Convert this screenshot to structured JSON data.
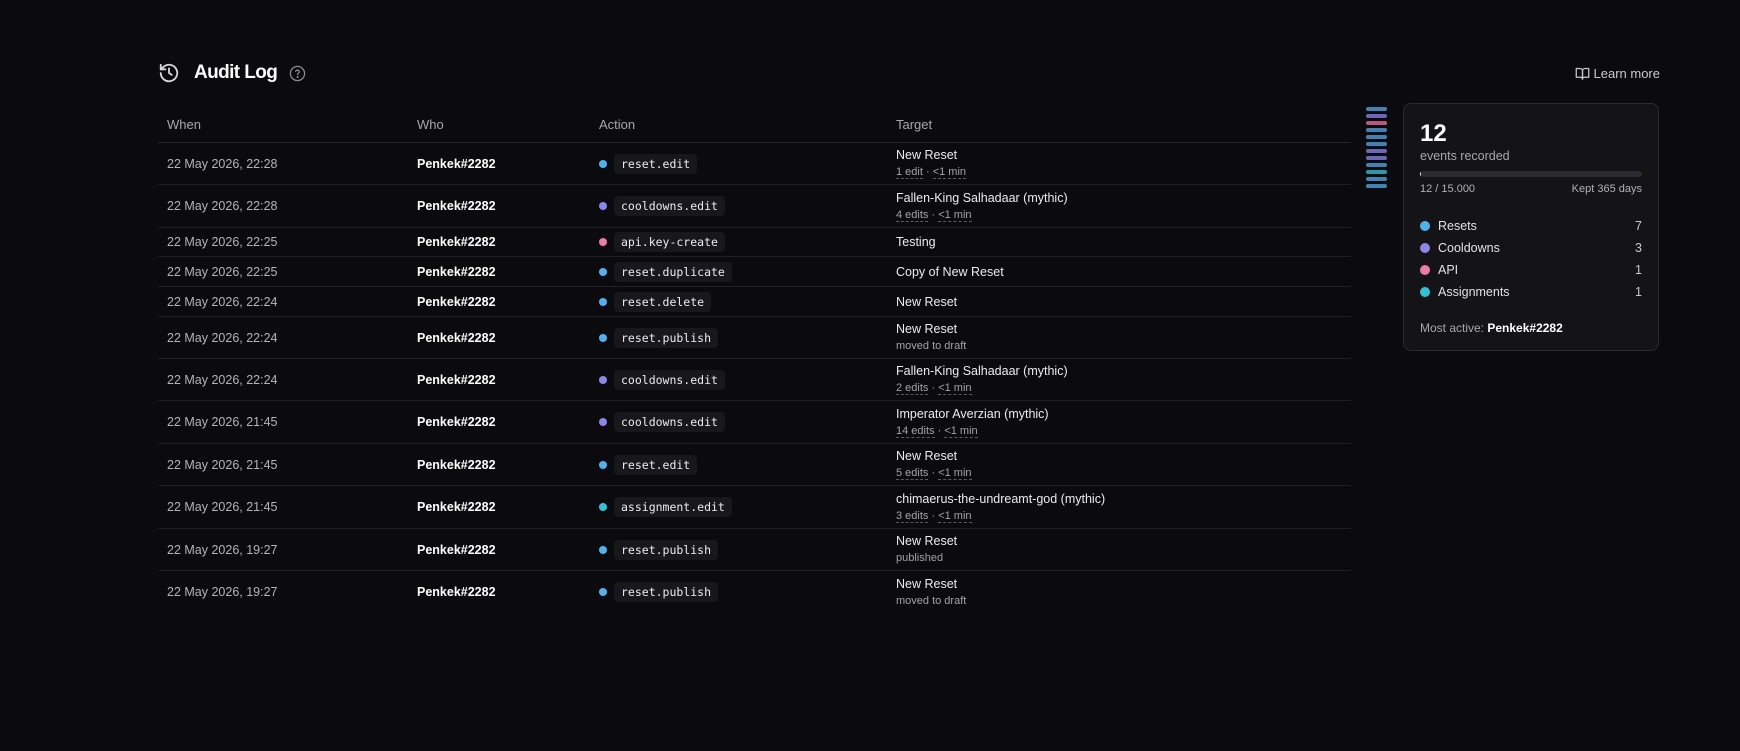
{
  "header": {
    "title": "Audit Log",
    "learn_more": "Learn more"
  },
  "table": {
    "columns": {
      "when": "When",
      "who": "Who",
      "action": "Action",
      "target": "Target"
    },
    "rows": [
      {
        "when": "22 May 2026, 22:28",
        "who": "Penkek#2282",
        "action": "reset.edit",
        "color": "#4db3f0",
        "target": "New Reset",
        "sub": "1 edit · <1 min"
      },
      {
        "when": "22 May 2026, 22:28",
        "who": "Penkek#2282",
        "action": "cooldowns.edit",
        "color": "#8a86ea",
        "target": "Fallen-King Salhadaar (mythic)",
        "sub": "4 edits · <1 min"
      },
      {
        "when": "22 May 2026, 22:25",
        "who": "Penkek#2282",
        "action": "api.key-create",
        "color": "#ee7aa6",
        "target": "Testing",
        "sub": ""
      },
      {
        "when": "22 May 2026, 22:25",
        "who": "Penkek#2282",
        "action": "reset.duplicate",
        "color": "#4db3f0",
        "target": "Copy of New Reset",
        "sub": ""
      },
      {
        "when": "22 May 2026, 22:24",
        "who": "Penkek#2282",
        "action": "reset.delete",
        "color": "#4db3f0",
        "target": "New Reset",
        "sub": ""
      },
      {
        "when": "22 May 2026, 22:24",
        "who": "Penkek#2282",
        "action": "reset.publish",
        "color": "#4db3f0",
        "target": "New Reset",
        "sub": "moved to draft"
      },
      {
        "when": "22 May 2026, 22:24",
        "who": "Penkek#2282",
        "action": "cooldowns.edit",
        "color": "#8a86ea",
        "target": "Fallen-King Salhadaar (mythic)",
        "sub": "2 edits · <1 min"
      },
      {
        "when": "22 May 2026, 21:45",
        "who": "Penkek#2282",
        "action": "cooldowns.edit",
        "color": "#8a86ea",
        "target": "Imperator Averzian (mythic)",
        "sub": "14 edits · <1 min"
      },
      {
        "when": "22 May 2026, 21:45",
        "who": "Penkek#2282",
        "action": "reset.edit",
        "color": "#4db3f0",
        "target": "New Reset",
        "sub": "5 edits · <1 min"
      },
      {
        "when": "22 May 2026, 21:45",
        "who": "Penkek#2282",
        "action": "assignment.edit",
        "color": "#2ec4d6",
        "target": "chimaerus-the-undreamt-god (mythic)",
        "sub": "3 edits · <1 min"
      },
      {
        "when": "22 May 2026, 19:27",
        "who": "Penkek#2282",
        "action": "reset.publish",
        "color": "#4db3f0",
        "target": "New Reset",
        "sub": "published"
      },
      {
        "when": "22 May 2026, 19:27",
        "who": "Penkek#2282",
        "action": "reset.publish",
        "color": "#4db3f0",
        "target": "New Reset",
        "sub": "moved to draft"
      }
    ]
  },
  "minimap": {
    "bars": [
      "#3f82b5",
      "#6a66b8",
      "#b8587f",
      "#3f82b5",
      "#3f82b5",
      "#3f82b5",
      "#6a66b8",
      "#6a66b8",
      "#3f82b5",
      "#279aa8",
      "#3f82b5",
      "#3f82b5"
    ]
  },
  "stats": {
    "count": "12",
    "count_label": "events recorded",
    "progress_fraction": 0.0008,
    "progress_text": "12 / 15.000",
    "retention": "Kept 365 days",
    "legend": [
      {
        "label": "Resets",
        "value": "7",
        "color": "#4db3f0"
      },
      {
        "label": "Cooldowns",
        "value": "3",
        "color": "#8a86ea"
      },
      {
        "label": "API",
        "value": "1",
        "color": "#ee7aa6"
      },
      {
        "label": "Assignments",
        "value": "1",
        "color": "#2ec4d6"
      }
    ],
    "most_active_label": "Most active:",
    "most_active_user": "Penkek#2282"
  },
  "icons": {
    "title": "history-icon",
    "help": "help-circle-icon",
    "learn_more": "book-open-icon"
  }
}
